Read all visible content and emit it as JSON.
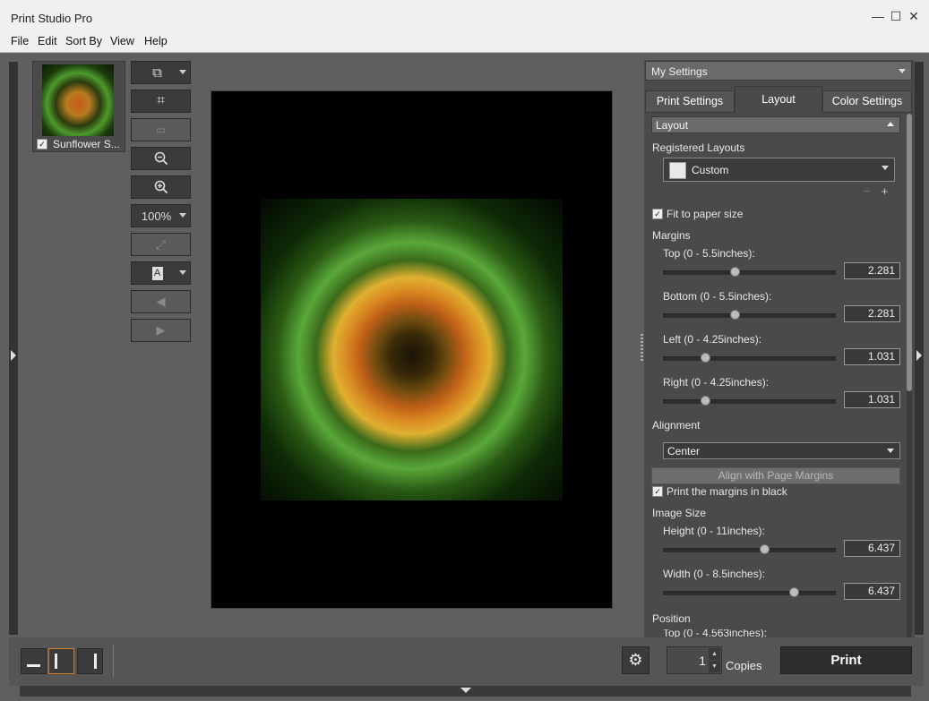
{
  "window": {
    "title": "Print Studio Pro",
    "controls": {
      "minimize": "—",
      "maximize": "☐",
      "close": "✕"
    }
  },
  "menu": [
    {
      "label": "File"
    },
    {
      "label": "Edit"
    },
    {
      "label": "Sort By"
    },
    {
      "label": "View"
    },
    {
      "label": "Help"
    }
  ],
  "thumbnail": {
    "label": "Sunflower S...",
    "checked": true
  },
  "toolbar": {
    "zoom_value": "100%",
    "icons": [
      "layout-switch-icon",
      "crop-icon",
      "image-info-icon",
      "zoom-out-icon",
      "zoom-in-icon",
      "zoom-select-icon",
      "fit-icon",
      "text-icon",
      "previous-icon",
      "next-icon"
    ]
  },
  "settings": {
    "selected": "My Settings"
  },
  "tabs": [
    {
      "label": "Print Settings"
    },
    {
      "label": "Layout",
      "active": true
    },
    {
      "label": "Color Settings"
    }
  ],
  "layout_panel": {
    "section_title": "Layout",
    "registered_layouts_label": "Registered Layouts",
    "registered_layout_value": "Custom",
    "fit_to_paper_label": "Fit to paper size",
    "fit_to_paper_checked": true,
    "margins_label": "Margins",
    "margins": [
      {
        "label": "Top (0 - 5.5inches):",
        "value": "2.281",
        "fraction": 0.414
      },
      {
        "label": "Bottom (0 - 5.5inches):",
        "value": "2.281",
        "fraction": 0.414
      },
      {
        "label": "Left (0 - 4.25inches):",
        "value": "1.031",
        "fraction": 0.243
      },
      {
        "label": "Right (0 - 4.25inches):",
        "value": "1.031",
        "fraction": 0.243
      }
    ],
    "alignment_label": "Alignment",
    "alignment_value": "Center",
    "align_with_margins_label": "Align with Page Margins",
    "print_margins_black_label": "Print the margins in black",
    "print_margins_black_checked": true,
    "image_size_label": "Image Size",
    "image_size": [
      {
        "label": "Height (0 - 11inches):",
        "value": "6.437",
        "fraction": 0.585
      },
      {
        "label": "Width (0 - 8.5inches):",
        "value": "6.437",
        "fraction": 0.757
      }
    ],
    "position_label": "Position",
    "position_partial": "Top (0 - 4.563inches):"
  },
  "bottom": {
    "copies_value": "1",
    "copies_label": "Copies",
    "print_label": "Print"
  },
  "colors": {
    "accent": "#d27b2c"
  }
}
